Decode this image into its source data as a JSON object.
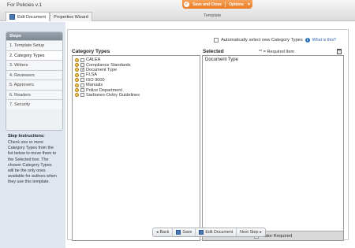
{
  "app": {
    "title": "For Policies v.1",
    "subtitle": "Template"
  },
  "tabs": [
    {
      "label": "Edit Document"
    },
    {
      "label": "Properties Wizard"
    }
  ],
  "orange_toolbar": {
    "save_close": "Save and Close",
    "options": "Options",
    "options_arrow": "▼"
  },
  "sidebar": {
    "steps_title": "Steps",
    "steps": [
      "1. Template Setup",
      "2. Category Types",
      "3. Writers",
      "4. Reviewers",
      "5. Approvers",
      "6. Readers",
      "7. Security"
    ],
    "active_step_index": 1,
    "instructions_title": "Step Instructions:",
    "instructions_text": "Check one or more Category Types from the list below to move them to the Selected box. The chosen Category Types will be the only ones available for authors when they use this template."
  },
  "auto_select": {
    "label": "Automatically select new Category Types",
    "help_link": "What is this?",
    "checked": false
  },
  "category_types": {
    "label": "Category Types",
    "items": [
      {
        "label": "CALEA",
        "checked": false
      },
      {
        "label": "Compliance Standards",
        "checked": false
      },
      {
        "label": "Document Type",
        "checked": true
      },
      {
        "label": "FLSA",
        "checked": false
      },
      {
        "label": "ISO 9000",
        "checked": false
      },
      {
        "label": "Manuals",
        "checked": false
      },
      {
        "label": "Police Department",
        "checked": false
      },
      {
        "label": "Sarbanes-Oxley Guidelines",
        "checked": false
      }
    ]
  },
  "selected": {
    "label": "Selected",
    "required_note": "** = Required Item",
    "items": [
      "Document Type"
    ],
    "make_required_label": "Make Required"
  },
  "nav": {
    "back": "Back",
    "save": "Save",
    "edit_document": "Edit Document",
    "next_step": "Next Step"
  },
  "colors": {
    "accent_orange": "#e87a24",
    "sidebar_bg": "#dfe6ef",
    "link_blue": "#2f5fa6"
  }
}
